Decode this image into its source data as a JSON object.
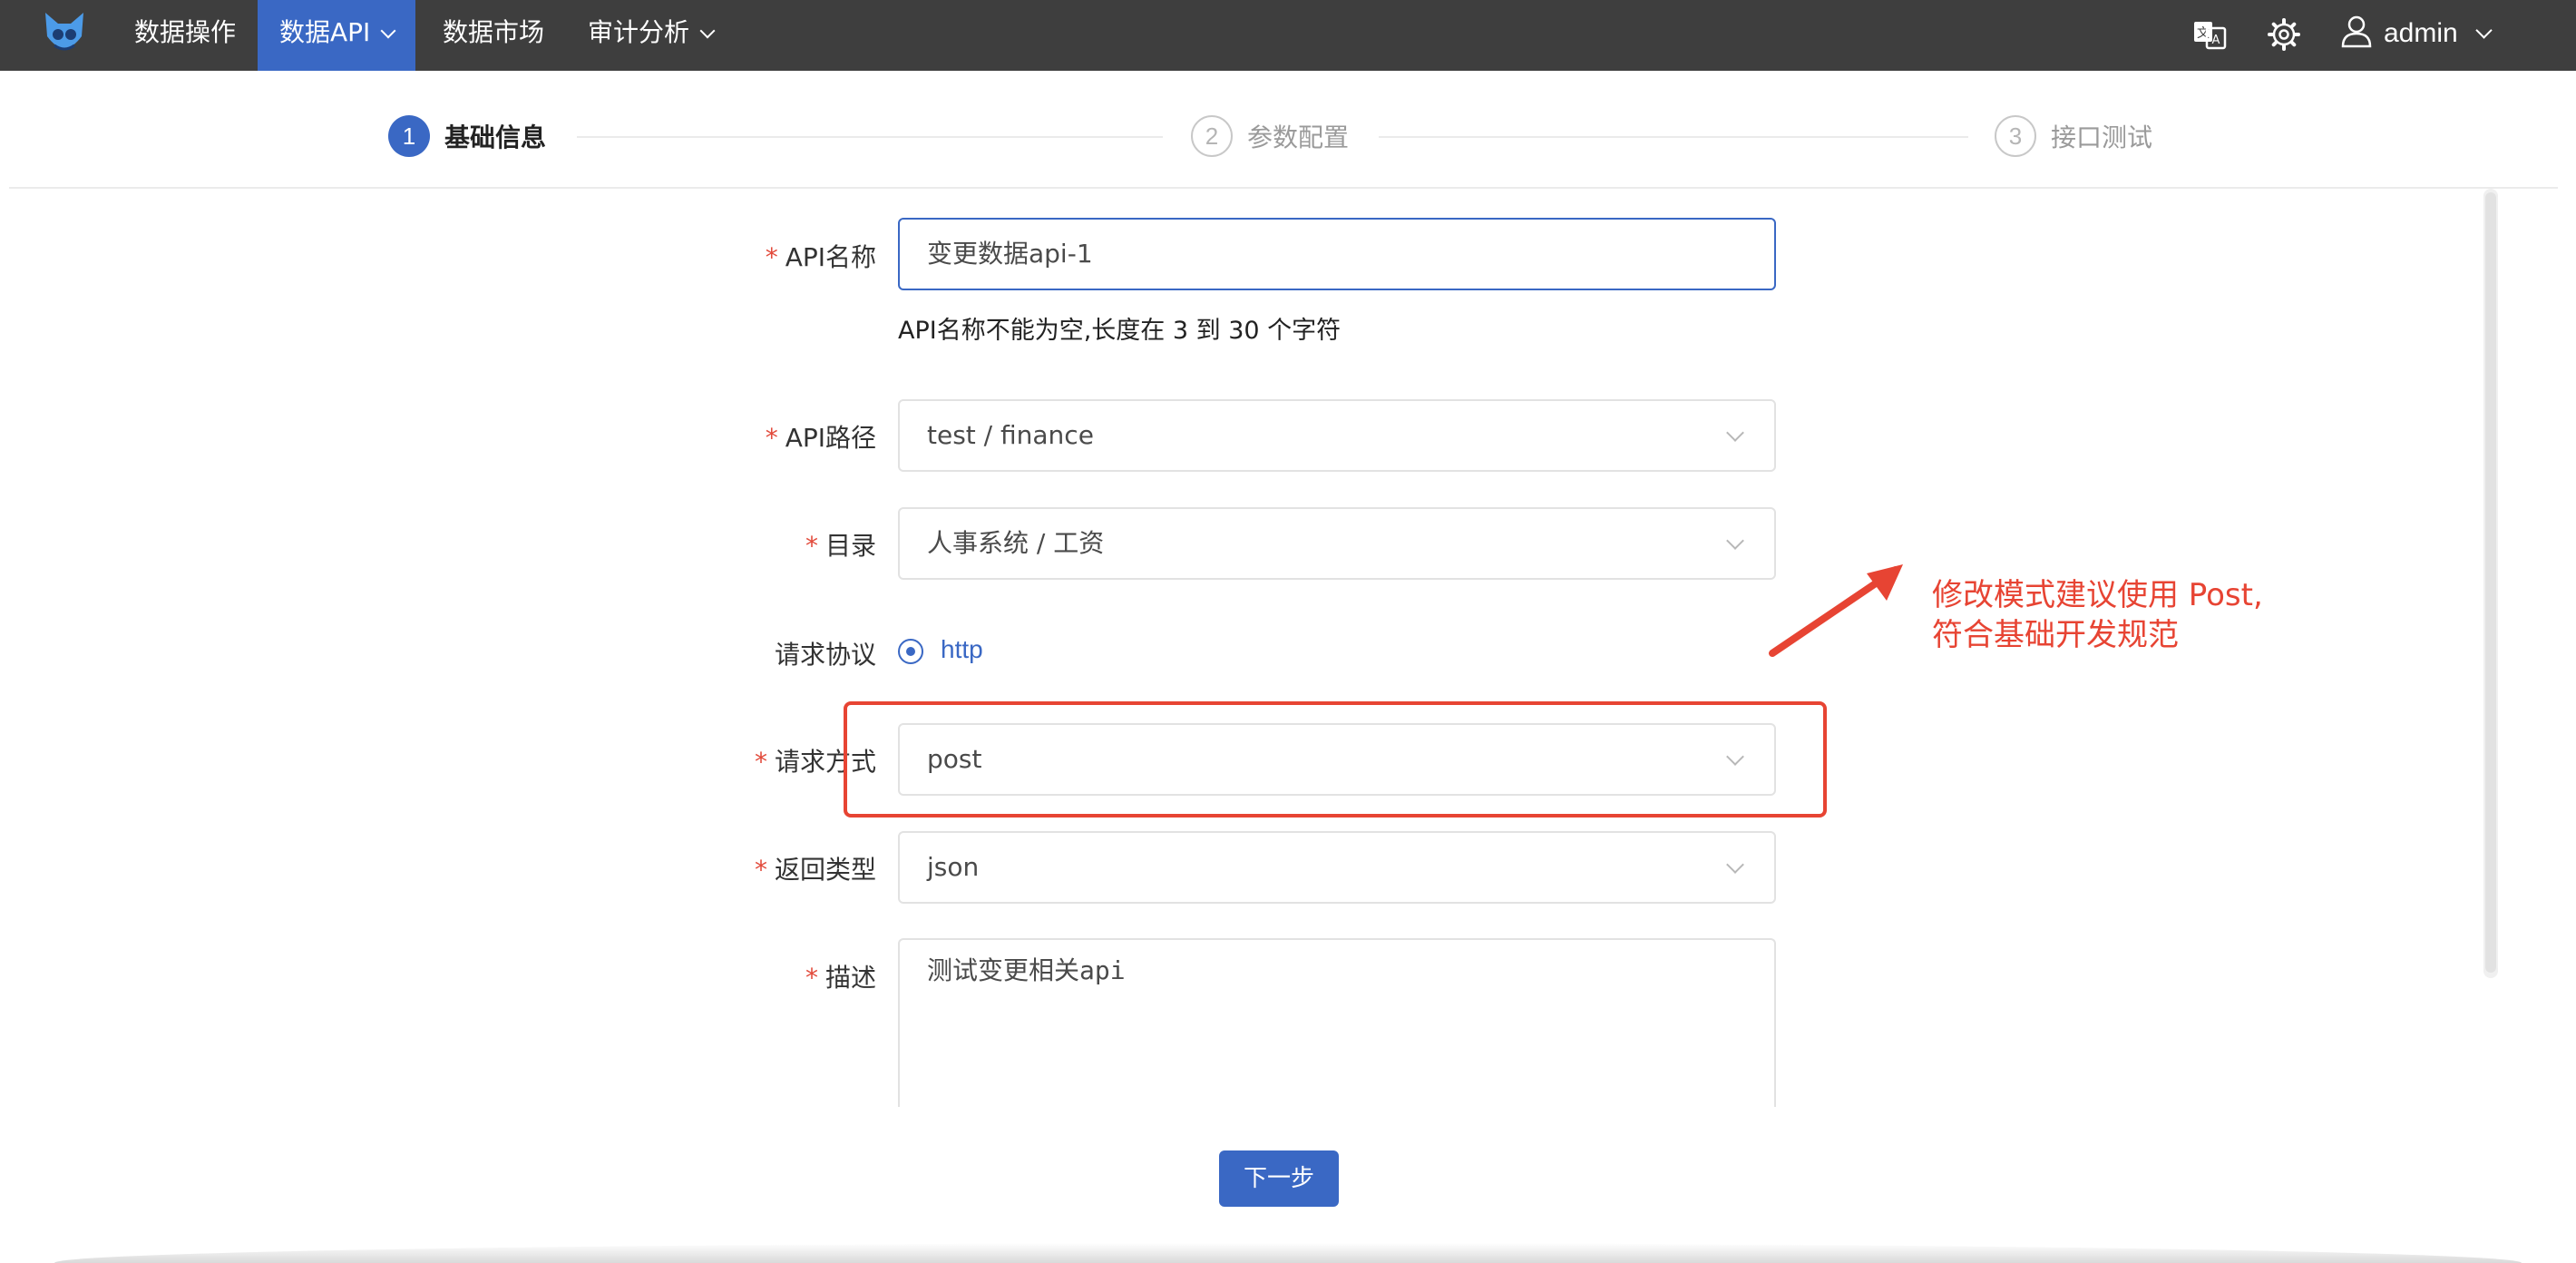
{
  "nav": {
    "items": [
      {
        "label": "数据操作"
      },
      {
        "label": "数据API"
      },
      {
        "label": "数据市场"
      },
      {
        "label": "审计分析"
      }
    ],
    "user": "admin",
    "accent": "#3a68c4"
  },
  "steps": [
    {
      "num": "1",
      "label": "基础信息"
    },
    {
      "num": "2",
      "label": "参数配置"
    },
    {
      "num": "3",
      "label": "接口测试"
    }
  ],
  "form": {
    "api_name": {
      "label": "API名称",
      "value": "变更数据api-1",
      "hint": "API名称不能为空,长度在 3 到 30 个字符"
    },
    "api_path": {
      "label": "API路径",
      "value": "test / finance"
    },
    "directory": {
      "label": "目录",
      "value": "人事系统 / 工资"
    },
    "protocol": {
      "label": "请求协议",
      "value": "http"
    },
    "method": {
      "label": "请求方式",
      "value": "post"
    },
    "return_type": {
      "label": "返回类型",
      "value": "json"
    },
    "description": {
      "label": "描述",
      "value": "测试变更相关api"
    },
    "required_mark": "*"
  },
  "annotation": {
    "line1": "修改模式建议使用 Post,",
    "line2": "符合基础开发规范",
    "color": "#e74433"
  },
  "buttons": {
    "next": "下一步"
  },
  "icons": [
    "logo-icon",
    "translate-icon",
    "settings-icon",
    "user-icon"
  ]
}
